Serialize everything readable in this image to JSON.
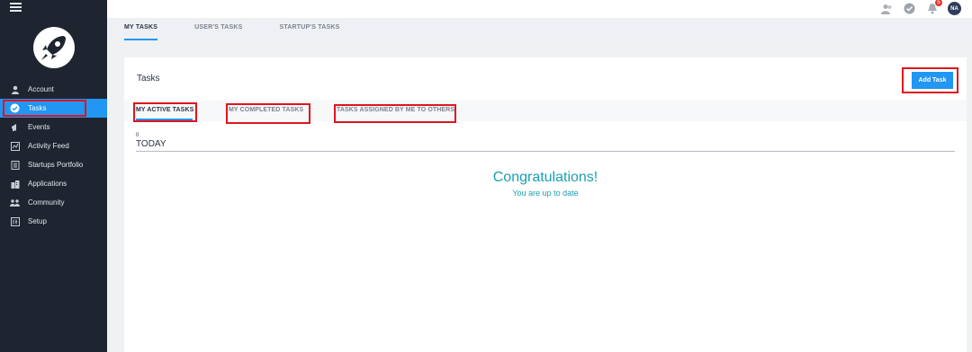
{
  "sidebar": {
    "items": [
      {
        "label": "Account",
        "icon": "user-icon"
      },
      {
        "label": "Tasks",
        "icon": "check-circle-icon"
      },
      {
        "label": "Events",
        "icon": "megaphone-icon"
      },
      {
        "label": "Activity Feed",
        "icon": "chart-icon"
      },
      {
        "label": "Startups Portfolio",
        "icon": "portfolio-icon"
      },
      {
        "label": "Applications",
        "icon": "building-icon"
      },
      {
        "label": "Community",
        "icon": "people-icon"
      },
      {
        "label": "Setup",
        "icon": "setup-icon"
      }
    ]
  },
  "topbar": {
    "notification_count": "5",
    "avatar_initials": "NA"
  },
  "subtabs": [
    {
      "label": "MY TASKS"
    },
    {
      "label": "USER'S TASKS"
    },
    {
      "label": "STARTUP'S TASKS"
    }
  ],
  "card": {
    "title": "Tasks",
    "add_button": "Add Task",
    "tabs": [
      {
        "label": "MY ACTIVE TASKS"
      },
      {
        "label": "MY COMPLETED TASKS"
      },
      {
        "label": "TASKS ASSIGNED BY ME TO OTHERS"
      }
    ],
    "count": "0",
    "group_label": "TODAY",
    "empty_title": "Congratulations!",
    "empty_subtitle": "You are up to date"
  },
  "colors": {
    "sidebar_bg": "#1f2431",
    "accent": "#2196f3",
    "highlight": "#e0141e",
    "empty_text": "#1a9fb0"
  }
}
